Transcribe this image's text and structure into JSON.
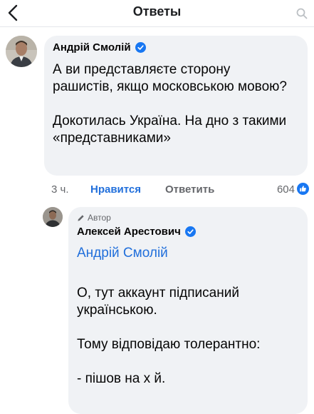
{
  "header": {
    "title": "Ответы"
  },
  "comment": {
    "author": "Андрій Смолій",
    "text": "А ви представляєте сторону рашистів, якщо московською мовою?\n\nДокотилась Україна. На дно з такими «представниками»",
    "time": "3 ч.",
    "like_label": "Нравится",
    "reply_label": "Ответить",
    "reaction_count": "604"
  },
  "reply": {
    "author_badge": "Автор",
    "author": "Алексей Арестович",
    "mention": "Андрій Смолій",
    "text": "О, тут аккаунт підписаний українською.\n\nТому відповідаю толерантно:\n\n- пішов на х й."
  },
  "colors": {
    "link": "#216fdb",
    "bubble": "#f0f2f5",
    "verified": "#1877f2"
  }
}
